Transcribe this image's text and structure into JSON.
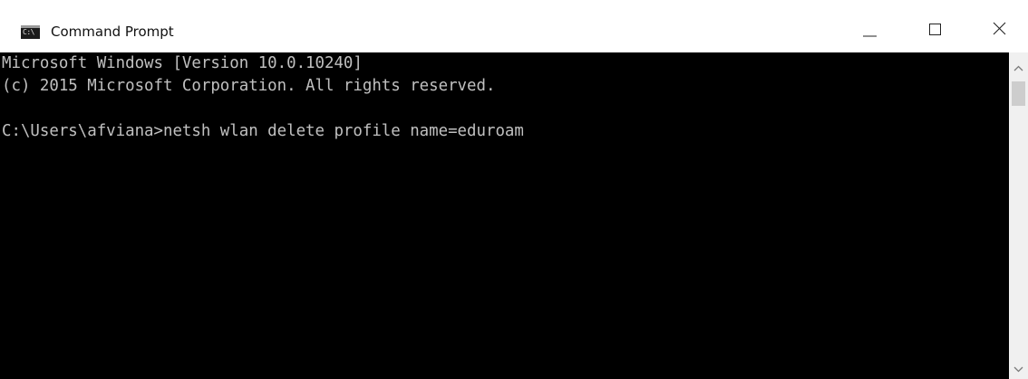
{
  "window": {
    "title": "Command Prompt",
    "icon": "command-prompt-icon",
    "icon_glyph": "C:\\",
    "controls": {
      "minimize": "minimize-icon",
      "maximize": "maximize-icon",
      "close": "close-icon"
    }
  },
  "console": {
    "lines": [
      "Microsoft Windows [Version 10.0.10240]",
      "(c) 2015 Microsoft Corporation. All rights reserved.",
      "",
      "C:\\Users\\afviana>netsh wlan delete profile name=eduroam"
    ],
    "background_color": "#000000",
    "text_color": "#c0c0c0"
  },
  "scrollbar": {
    "up_icon": "chevron-up-icon",
    "down_icon": "chevron-down-icon"
  }
}
